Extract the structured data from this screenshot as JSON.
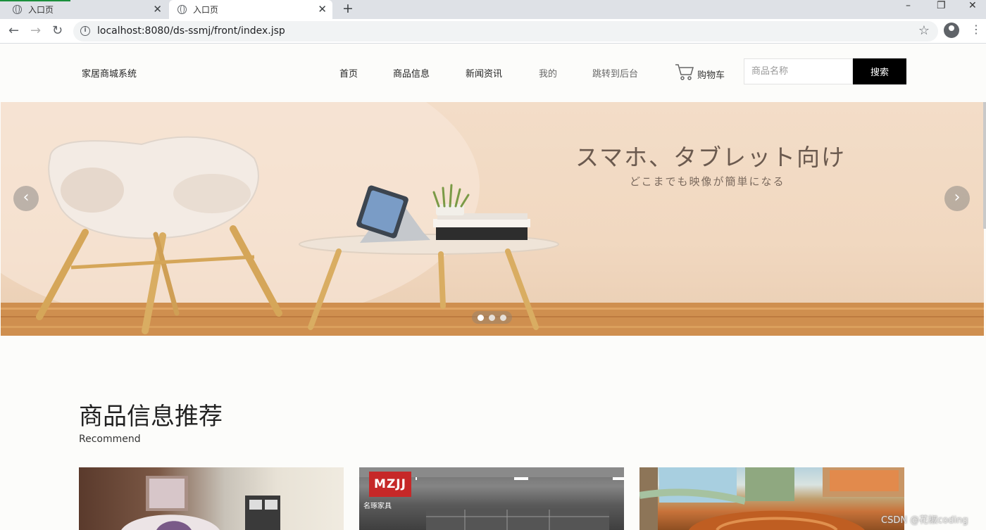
{
  "browser": {
    "tabs": [
      {
        "title": "入口页",
        "active": false
      },
      {
        "title": "入口页",
        "active": true
      }
    ],
    "new_tab": "+",
    "url": "localhost:8080/ds-ssmj/front/index.jsp",
    "window_controls": {
      "minimize": "–",
      "restore": "❐",
      "close": "✕"
    },
    "icons": {
      "back": "←",
      "forward": "→",
      "reload": "↻",
      "star": "☆",
      "menu": "⋮",
      "info": "i",
      "tab_close": "✕"
    }
  },
  "header": {
    "logo": "家居商城系统",
    "nav": [
      "首页",
      "商品信息",
      "新闻资讯",
      "我的",
      "跳转到后台"
    ],
    "cart_label": "购物车",
    "search_placeholder": "商品名称",
    "search_button": "搜索"
  },
  "banner": {
    "title": "スマホ、タブレット向け",
    "subtitle": "どこまでも映像が簡単になる",
    "prev": "‹",
    "next": "›",
    "slides": 3,
    "active_slide": 1
  },
  "recommend": {
    "title": "商品信息推荐",
    "subtitle": "Recommend",
    "cards": [
      {
        "badge": "",
        "badge_sub": ""
      },
      {
        "badge": "MZJJ",
        "badge_sub": "名琢家具"
      },
      {
        "badge": "",
        "badge_sub": ""
      }
    ]
  },
  "watermark": "CSDN @花椒coding",
  "colors": {
    "search_button_bg": "#000000",
    "page_bg": "#fcfcfa"
  }
}
